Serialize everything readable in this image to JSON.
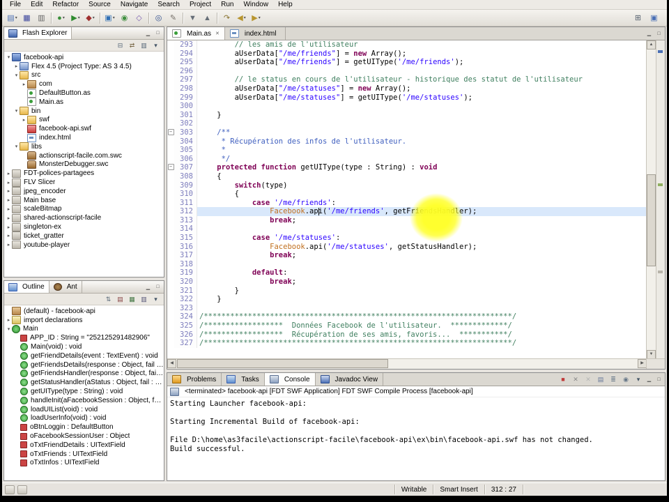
{
  "menu": {
    "items": [
      "File",
      "Edit",
      "Refactor",
      "Source",
      "Navigate",
      "Search",
      "Project",
      "Run",
      "Window",
      "Help"
    ]
  },
  "chrome": {
    "min_max": [
      {
        "name": "minimize-icon",
        "glyph": "▁"
      },
      {
        "name": "maximize-icon",
        "glyph": "□"
      }
    ]
  },
  "toolbar": {
    "g1": [
      {
        "name": "new-wizard-button",
        "glyph": "▤",
        "color": "#4a6fb5",
        "cls": "dd"
      },
      {
        "name": "save-button",
        "glyph": "▦",
        "color": "#39439c"
      },
      {
        "name": "print-button",
        "glyph": "▥",
        "color": "#666666"
      }
    ],
    "g2": [
      {
        "name": "debug-button",
        "glyph": "●",
        "color": "#3a8f3a",
        "cls": "dd"
      },
      {
        "name": "run-button",
        "glyph": "▶",
        "color": "#2e8b2e",
        "cls": "dd"
      },
      {
        "name": "external-tools-button",
        "glyph": "◆",
        "color": "#a03030",
        "cls": "dd"
      }
    ],
    "g3": [
      {
        "name": "new-flash-project-button",
        "glyph": "▣",
        "color": "#2f6fb5",
        "cls": "dd"
      },
      {
        "name": "new-class-button",
        "glyph": "◉",
        "color": "#3f8f3f"
      },
      {
        "name": "new-interface-button",
        "glyph": "◇",
        "color": "#7a5fb0"
      }
    ],
    "g4": [
      {
        "name": "search-button",
        "glyph": "◎",
        "color": "#33518f"
      },
      {
        "name": "mark-occurrences-button",
        "glyph": "✎",
        "color": "#77716a"
      }
    ],
    "g5": [
      {
        "name": "next-annotation-button",
        "glyph": "▼",
        "color": "#666e77"
      },
      {
        "name": "previous-annotation-button",
        "glyph": "▲",
        "color": "#666e77"
      }
    ],
    "g6": [
      {
        "name": "last-edit-location-button",
        "glyph": "↷",
        "color": "#8a7430"
      },
      {
        "name": "back-button",
        "glyph": "◀",
        "color": "#b8952f",
        "cls": "dd"
      },
      {
        "name": "forward-button",
        "glyph": "▶",
        "color": "#b8952f",
        "cls": "dd"
      }
    ],
    "right": [
      {
        "name": "open-perspective-button",
        "glyph": "⊞",
        "color": "#55606e"
      },
      {
        "name": "flash-perspective-button",
        "glyph": "▣",
        "color": "#4a6fb5"
      }
    ]
  },
  "explorer": {
    "title": "Flash Explorer",
    "tools": [
      {
        "name": "collapse-all-icon",
        "glyph": "⊟",
        "color": "#556677"
      },
      {
        "name": "link-with-editor-icon",
        "glyph": "⇄",
        "color": "#776644"
      },
      {
        "name": "filter-icon",
        "glyph": "▥",
        "color": "#556677"
      },
      {
        "name": "view-menu-icon",
        "glyph": "▾",
        "color": "#445566"
      }
    ],
    "tree": [
      {
        "label": "facebook-api",
        "icon": "flash-project",
        "arrow": "open",
        "level": 0
      },
      {
        "label": "Flex 4.5 (Project Type: AS 3 4.5)",
        "icon": "flex-sdk",
        "arrow": "closed",
        "level": 1
      },
      {
        "label": "src",
        "icon": "source-folder",
        "arrow": "open",
        "level": 1
      },
      {
        "label": "com",
        "icon": "package",
        "arrow": "closed",
        "level": 2
      },
      {
        "label": "DefaultButton.as",
        "icon": "as-file",
        "arrow": "none",
        "level": 2
      },
      {
        "label": "Main.as",
        "icon": "as-file",
        "arrow": "none",
        "level": 2
      },
      {
        "label": "bin",
        "icon": "folder",
        "arrow": "open",
        "level": 1
      },
      {
        "label": "swf",
        "icon": "folder",
        "arrow": "closed",
        "level": 2
      },
      {
        "label": "facebook-api.swf",
        "icon": "swf-file",
        "arrow": "none",
        "level": 2
      },
      {
        "label": "index.html",
        "icon": "html-file",
        "arrow": "none",
        "level": 2
      },
      {
        "label": "libs",
        "icon": "folder",
        "arrow": "open",
        "level": 1
      },
      {
        "label": "actionscript-facile.com.swc",
        "icon": "swc-archive",
        "arrow": "none",
        "level": 2
      },
      {
        "label": "MonsterDebugger.swc",
        "icon": "swc-archive",
        "arrow": "none",
        "level": 2
      },
      {
        "label": "FDT-polices-partagees",
        "icon": "closed-project",
        "arrow": "closed",
        "level": 0
      },
      {
        "label": "FLV Slicer",
        "icon": "closed-project",
        "arrow": "closed",
        "level": 0
      },
      {
        "label": "jpeg_encoder",
        "icon": "closed-project",
        "arrow": "closed",
        "level": 0
      },
      {
        "label": "Main base",
        "icon": "closed-project",
        "arrow": "closed",
        "level": 0
      },
      {
        "label": "scaleBitmap",
        "icon": "closed-project",
        "arrow": "closed",
        "level": 0
      },
      {
        "label": "shared-actionscript-facile",
        "icon": "closed-project",
        "arrow": "closed",
        "level": 0
      },
      {
        "label": "singleton-ex",
        "icon": "closed-project",
        "arrow": "closed",
        "level": 0
      },
      {
        "label": "ticket_gratter",
        "icon": "closed-project",
        "arrow": "closed",
        "level": 0
      },
      {
        "label": "youtube-player",
        "icon": "closed-project",
        "arrow": "closed",
        "level": 0
      }
    ]
  },
  "outline": {
    "tabs": [
      {
        "label": "Outline",
        "icon": "outline-icon",
        "cls": "active"
      },
      {
        "label": "Ant",
        "icon": "ant-icon",
        "cls": ""
      }
    ],
    "tools": [
      {
        "name": "sort-icon",
        "glyph": "⇅",
        "color": "#556677"
      },
      {
        "name": "hide-fields-icon",
        "glyph": "▤",
        "color": "#884444"
      },
      {
        "name": "hide-static-icon",
        "glyph": "▦",
        "color": "#447744"
      },
      {
        "name": "hide-non-public-icon",
        "glyph": "▥",
        "color": "#555577"
      },
      {
        "name": "view-menu-icon",
        "glyph": "▾",
        "color": "#445566"
      }
    ],
    "items": [
      {
        "label": "(default) - facebook-api",
        "icon": "package",
        "arrow": "none",
        "level": 0
      },
      {
        "label": "import declarations",
        "icon": "imports",
        "arrow": "closed",
        "level": 0
      },
      {
        "label": "Main",
        "icon": "class",
        "arrow": "open",
        "level": 0
      },
      {
        "label": "APP_ID : String = \"252125291482906\"",
        "icon": "field-private",
        "arrow": "none",
        "level": 1
      },
      {
        "label": "Main(void) : void",
        "icon": "method-public",
        "arrow": "none",
        "level": 1
      },
      {
        "label": "getFriendDetails(event : TextEvent) : void",
        "icon": "method-public",
        "arrow": "none",
        "level": 1
      },
      {
        "label": "getFriendsDetails(response : Object, fail : O...",
        "icon": "method-public",
        "arrow": "none",
        "level": 1
      },
      {
        "label": "getFriendsHandler(response : Object, fail : ...",
        "icon": "method-public",
        "arrow": "none",
        "level": 1
      },
      {
        "label": "getStatusHandler(aStatus : Object, fail : Obj...",
        "icon": "method-public",
        "arrow": "none",
        "level": 1
      },
      {
        "label": "getUIType(type : String) : void",
        "icon": "method-public",
        "arrow": "none",
        "level": 1
      },
      {
        "label": "handleInit(aFacebookSession : Object, fail...",
        "icon": "method-public",
        "arrow": "none",
        "level": 1
      },
      {
        "label": "loadUIList(void) : void",
        "icon": "method-public",
        "arrow": "none",
        "level": 1
      },
      {
        "label": "loadUserInfo(void) : void",
        "icon": "method-public",
        "arrow": "none",
        "level": 1
      },
      {
        "label": "oBtnLoggin : DefaultButton",
        "icon": "field-private",
        "arrow": "none",
        "level": 1
      },
      {
        "label": "oFacebookSessionUser : Object",
        "icon": "field-private",
        "arrow": "none",
        "level": 1
      },
      {
        "label": "oTxtFriendDetails : UITextField",
        "icon": "field-private",
        "arrow": "none",
        "level": 1
      },
      {
        "label": "oTxtFriends : UITextField",
        "icon": "field-private",
        "arrow": "none",
        "level": 1
      },
      {
        "label": "oTxtInfos : UITextField",
        "icon": "field-private",
        "arrow": "none",
        "level": 1
      }
    ]
  },
  "editor": {
    "tabs": [
      {
        "label": "Main.as",
        "icon": "as-file",
        "cls": "active",
        "close": "✕"
      },
      {
        "label": "index.html",
        "icon": "html-file",
        "cls": "",
        "close": ""
      }
    ],
    "lines": [
      {
        "n": 293,
        "segs": [
          [
            "        ",
            "p"
          ],
          [
            "// les amis de l'utilisateur",
            "c"
          ]
        ]
      },
      {
        "n": 294,
        "segs": [
          [
            "        aUserData[",
            "p"
          ],
          [
            "\"/me/friends\"",
            "s"
          ],
          [
            "] = ",
            "p"
          ],
          [
            "new",
            "k"
          ],
          [
            " Array();",
            "p"
          ]
        ]
      },
      {
        "n": 295,
        "segs": [
          [
            "        aUserData[",
            "p"
          ],
          [
            "\"/me/friends\"",
            "s"
          ],
          [
            "] = getUIType(",
            "p"
          ],
          [
            "'/me/friends'",
            "s"
          ],
          [
            ");",
            "p"
          ]
        ]
      },
      {
        "n": 296,
        "segs": []
      },
      {
        "n": 297,
        "segs": [
          [
            "        ",
            "p"
          ],
          [
            "// le status en cours de l'utilisateur - historique des statut de l'utilisateur",
            "c"
          ]
        ]
      },
      {
        "n": 298,
        "segs": [
          [
            "        aUserData[",
            "p"
          ],
          [
            "\"/me/statuses\"",
            "s"
          ],
          [
            "] = ",
            "p"
          ],
          [
            "new",
            "k"
          ],
          [
            " Array();",
            "p"
          ]
        ]
      },
      {
        "n": 299,
        "segs": [
          [
            "        aUserData[",
            "p"
          ],
          [
            "\"/me/statuses\"",
            "s"
          ],
          [
            "] = getUIType(",
            "p"
          ],
          [
            "'/me/statuses'",
            "s"
          ],
          [
            ");",
            "p"
          ]
        ]
      },
      {
        "n": 300,
        "segs": []
      },
      {
        "n": 301,
        "segs": [
          [
            "    }",
            "p"
          ]
        ]
      },
      {
        "n": 302,
        "segs": []
      },
      {
        "n": 303,
        "fold": "minus",
        "segs": [
          [
            "    ",
            "p"
          ],
          [
            "/**",
            "j"
          ]
        ]
      },
      {
        "n": 304,
        "segs": [
          [
            "     ",
            "p"
          ],
          [
            "* Récupération des infos de l'utilisateur.",
            "j"
          ]
        ]
      },
      {
        "n": 305,
        "segs": [
          [
            "     ",
            "p"
          ],
          [
            "*",
            "j"
          ]
        ]
      },
      {
        "n": 306,
        "segs": [
          [
            "     ",
            "p"
          ],
          [
            "*/",
            "j"
          ]
        ]
      },
      {
        "n": 307,
        "fold": "minus",
        "segs": [
          [
            "    ",
            "p"
          ],
          [
            "protected",
            "k"
          ],
          [
            " ",
            "p"
          ],
          [
            "function",
            "k"
          ],
          [
            " getUIType(type : String) : ",
            "p"
          ],
          [
            "void",
            "k"
          ]
        ]
      },
      {
        "n": 308,
        "segs": [
          [
            "    {",
            "p"
          ]
        ]
      },
      {
        "n": 309,
        "segs": [
          [
            "        ",
            "p"
          ],
          [
            "switch",
            "k"
          ],
          [
            "(type)",
            "p"
          ]
        ]
      },
      {
        "n": 310,
        "segs": [
          [
            "        {",
            "p"
          ]
        ]
      },
      {
        "n": 311,
        "segs": [
          [
            "            ",
            "p"
          ],
          [
            "case",
            "k"
          ],
          [
            " ",
            "p"
          ],
          [
            "'/me/friends'",
            "s"
          ],
          [
            ":",
            "p"
          ]
        ]
      },
      {
        "n": 312,
        "cls": "cur",
        "segs": [
          [
            "                ",
            "p"
          ],
          [
            "Facebook",
            "t"
          ],
          [
            ".api(",
            "p"
          ],
          [
            "'/me/friends'",
            "s"
          ],
          [
            ", getFriendsHandler);",
            "p"
          ]
        ]
      },
      {
        "n": 313,
        "segs": [
          [
            "                ",
            "p"
          ],
          [
            "break",
            "k"
          ],
          [
            ";",
            "p"
          ]
        ]
      },
      {
        "n": 314,
        "segs": []
      },
      {
        "n": 315,
        "segs": [
          [
            "            ",
            "p"
          ],
          [
            "case",
            "k"
          ],
          [
            " ",
            "p"
          ],
          [
            "'/me/statuses'",
            "s"
          ],
          [
            ":",
            "p"
          ]
        ]
      },
      {
        "n": 316,
        "segs": [
          [
            "                ",
            "p"
          ],
          [
            "Facebook",
            "t"
          ],
          [
            ".api(",
            "p"
          ],
          [
            "'/me/statuses'",
            "s"
          ],
          [
            ", getStatusHandler);",
            "p"
          ]
        ]
      },
      {
        "n": 317,
        "segs": [
          [
            "                ",
            "p"
          ],
          [
            "break",
            "k"
          ],
          [
            ";",
            "p"
          ]
        ]
      },
      {
        "n": 318,
        "segs": []
      },
      {
        "n": 319,
        "segs": [
          [
            "            ",
            "p"
          ],
          [
            "default",
            "k"
          ],
          [
            ":",
            "p"
          ]
        ]
      },
      {
        "n": 320,
        "segs": [
          [
            "                ",
            "p"
          ],
          [
            "break",
            "k"
          ],
          [
            ";",
            "p"
          ]
        ]
      },
      {
        "n": 321,
        "segs": [
          [
            "        }",
            "p"
          ]
        ]
      },
      {
        "n": 322,
        "segs": [
          [
            "    }",
            "p"
          ]
        ]
      },
      {
        "n": 323,
        "segs": []
      },
      {
        "n": 324,
        "segs": [
          [
            "/**********************************************************************/",
            "c"
          ]
        ]
      },
      {
        "n": 325,
        "segs": [
          [
            "/******************  Données Facebook de l'utilisateur.  *************/",
            "c"
          ]
        ]
      },
      {
        "n": 326,
        "segs": [
          [
            "/******************  Récupération de ses amis, favoris...  ***********/",
            "c"
          ]
        ]
      },
      {
        "n": 327,
        "segs": [
          [
            "/**********************************************************************/",
            "c"
          ]
        ]
      }
    ]
  },
  "console": {
    "tabs": [
      {
        "label": "Problems",
        "icon": "problems-icon",
        "cls": ""
      },
      {
        "label": "Tasks",
        "icon": "tasks-icon",
        "cls": ""
      },
      {
        "label": "Console",
        "icon": "console-icon",
        "cls": "active"
      },
      {
        "label": "Javadoc View",
        "icon": "javadoc-icon",
        "cls": ""
      }
    ],
    "tools": [
      {
        "name": "terminate-icon",
        "glyph": "■",
        "color": "#c03a3a"
      },
      {
        "name": "remove-launch-icon",
        "glyph": "✕",
        "color": "#888888"
      },
      {
        "name": "remove-all-launches-icon",
        "glyph": "✕",
        "color": "#b5b5b5"
      },
      {
        "name": "clear-console-icon",
        "glyph": "▤",
        "color": "#667799"
      },
      {
        "name": "scroll-lock-icon",
        "glyph": "≣",
        "color": "#667788"
      },
      {
        "name": "pin-console-icon",
        "glyph": "◉",
        "color": "#667788"
      },
      {
        "name": "open-console-icon",
        "glyph": "▾",
        "color": "#445566"
      }
    ],
    "header": "<terminated> facebook-api [FDT SWF Application] FDT SWF Compile Process [facebook-api]",
    "lines": [
      "Starting Launcher facebook-api:",
      "",
      "Starting Incremental Build of facebook-api:",
      "",
      "File D:\\home\\as3facile\\actionscript-facile\\facebook-api\\ex\\bin\\facebook-api.swf has not changed.",
      "Build successful."
    ]
  },
  "statusbar": {
    "writable": "Writable",
    "insert_mode": "Smart Insert",
    "caret_position": "312 : 27"
  }
}
